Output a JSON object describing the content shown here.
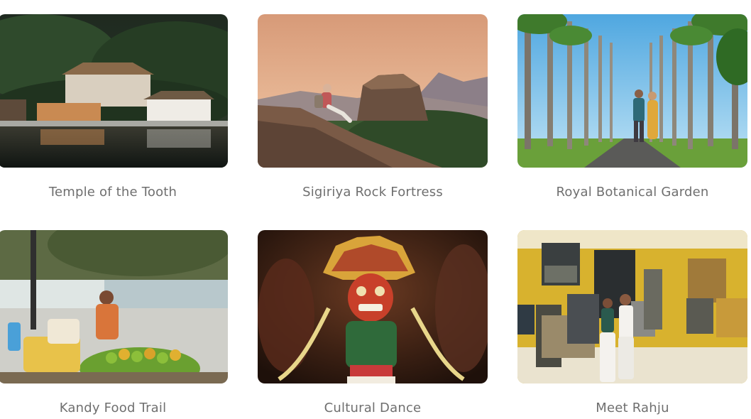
{
  "attractions": [
    {
      "title": "Temple of the Tooth"
    },
    {
      "title": "Sigiriya Rock Fortress"
    },
    {
      "title": "Royal Botanical Garden"
    },
    {
      "title": "Kandy Food Trail"
    },
    {
      "title": "Cultural Dance"
    },
    {
      "title": "Meet Rahju"
    }
  ]
}
